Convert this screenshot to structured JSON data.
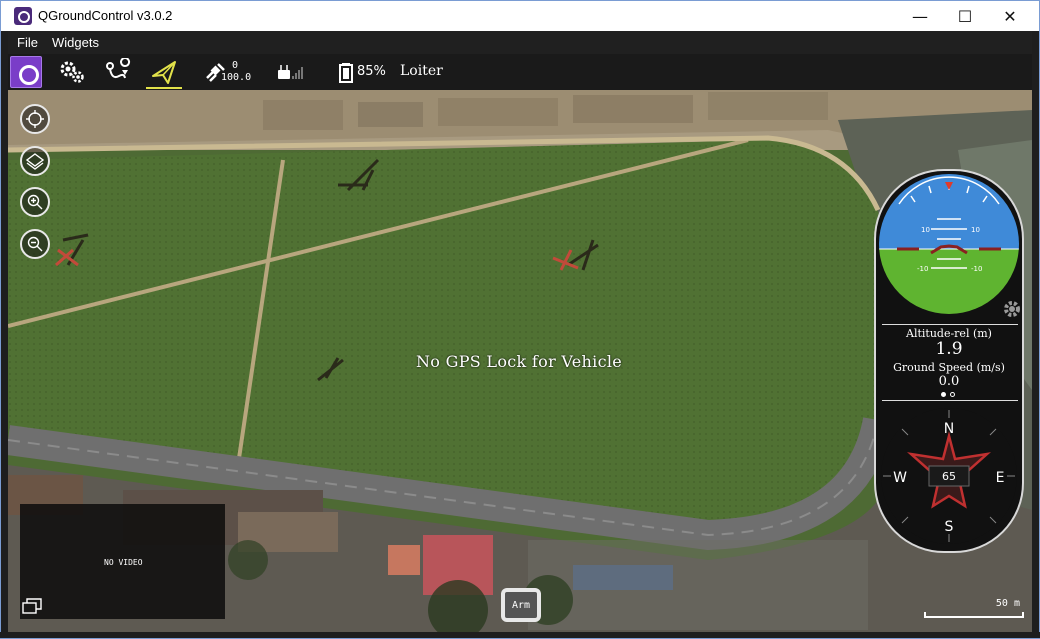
{
  "window": {
    "title": "QGroundControl v3.0.2",
    "minimize": "—",
    "maximize": "☐",
    "close": "✕"
  },
  "menu": {
    "file": "File",
    "widgets": "Widgets"
  },
  "toolbar": {
    "active_view": "fly",
    "gps_count": "0",
    "gps_hdop": "100.0",
    "battery": "85%",
    "flight_mode": "Loiter",
    "accent_color": "#e2e24a",
    "logo_color": "#7a3dc8"
  },
  "map": {
    "status_message": "No GPS Lock for Vehicle",
    "video_text": "NO VIDEO",
    "arm_label": "Arm",
    "scale_label": "50 m"
  },
  "instruments": {
    "pitch_ticks": [
      "10",
      "10",
      "-10",
      "-10"
    ],
    "altitude_label": "Altitude-rel (m)",
    "altitude_value": "1.9",
    "ground_speed_label": "Ground Speed (m/s)",
    "ground_speed_value": "0.0",
    "heading_value": "65",
    "compass_n": "N",
    "compass_e": "E",
    "compass_s": "S",
    "compass_w": "W",
    "sky_color": "#3f8ad8",
    "ground_color": "#5fb430"
  }
}
